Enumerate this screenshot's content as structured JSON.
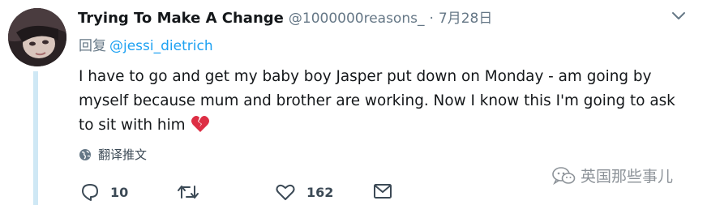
{
  "tweet": {
    "display_name": "Trying To Make A Change",
    "handle": "@1000000reasons_",
    "separator": "·",
    "date": "7月28日",
    "reply_prefix": "回复",
    "reply_to": "@jessi_dietrich",
    "text": "I have to go and get my baby boy Jasper put down on Monday - am going by myself because mum and brother are working. Now I know this I'm going to ask to sit with him",
    "emoji": "broken-heart-emoji",
    "translate_label": "翻译推文",
    "actions": {
      "reply_count": "10",
      "retweet_count": "",
      "like_count": "162"
    }
  },
  "watermark": {
    "text": "英国那些事儿"
  },
  "icons": {
    "caret": "chevron-down-icon",
    "globe": "globe-icon",
    "reply": "reply-icon",
    "retweet": "retweet-icon",
    "like": "heart-icon",
    "dm": "envelope-icon",
    "watermark": "wechat-icon"
  },
  "colors": {
    "link": "#1da1f2",
    "muted": "#657786",
    "text": "#14171a",
    "thread_line": "#cfe8f5",
    "heart_emoji": "#dd2e44"
  }
}
